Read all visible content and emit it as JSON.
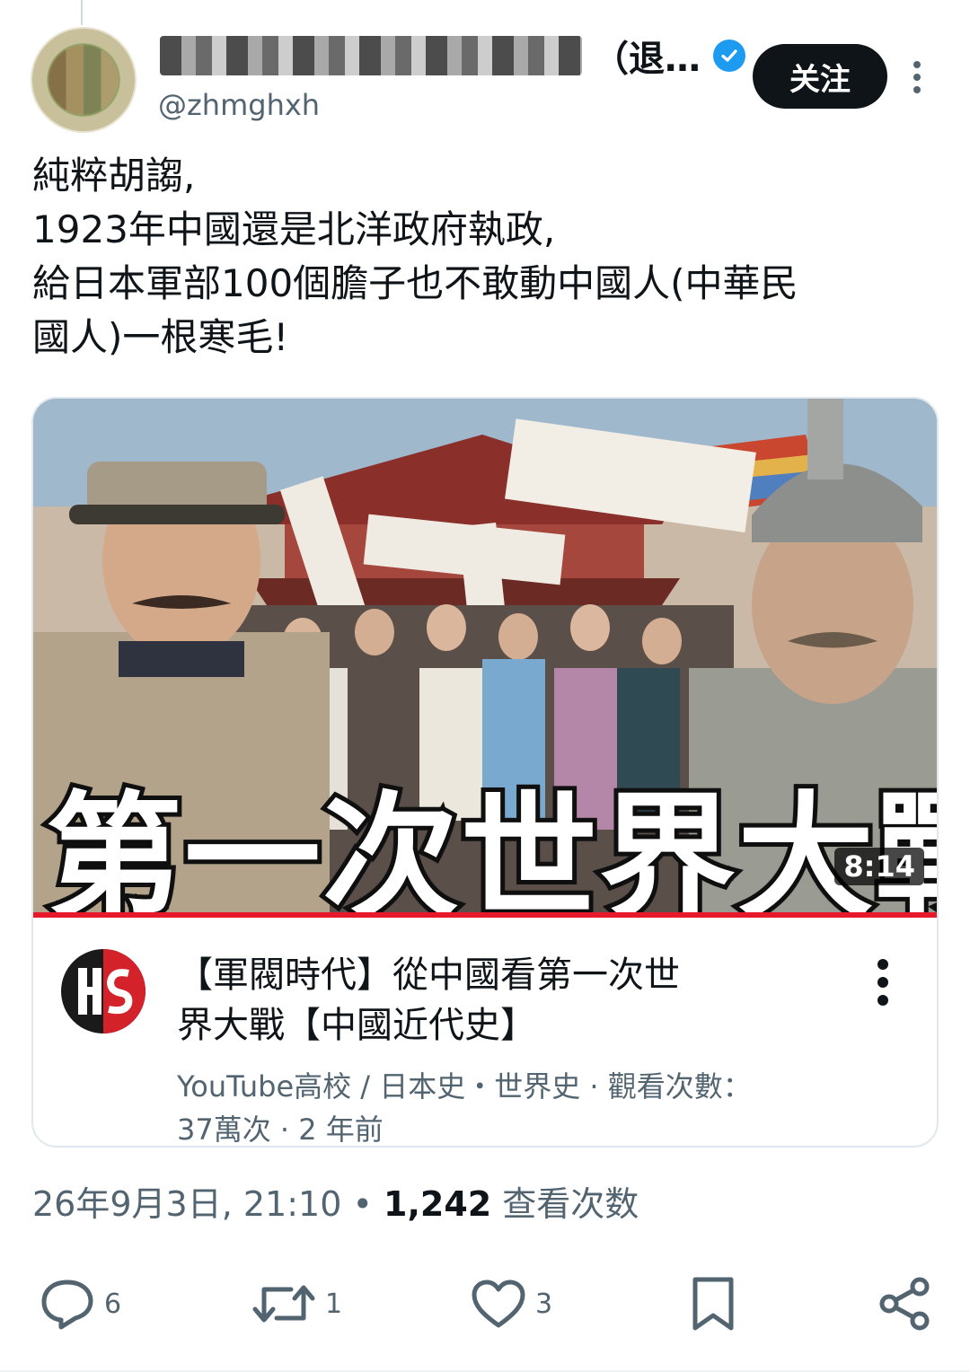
{
  "header": {
    "display_name_visible": "（退…",
    "handle": "@zhmghxh",
    "follow_label": "关注"
  },
  "tweet": {
    "lines": [
      "純粹胡謅,",
      "1923年中國還是北洋政府執政,",
      "給日本軍部100個膽子也不敢動中國人(中華民",
      "國人)一根寒毛!"
    ]
  },
  "card": {
    "thumbnail_title": "第一次世界大戰",
    "duration": "8:14",
    "title_lines": [
      "【軍閥時代】從中國看第一次世",
      "界大戰【中國近代史】"
    ],
    "meta_lines": [
      "YouTube高校 / 日本史・世界史 · 觀看次數：",
      "37萬次 · 2 年前"
    ]
  },
  "timestamp": {
    "datetime": "26年9月3日, 21:10",
    "separator": "•",
    "views_count": "1,242",
    "views_label": "查看次数"
  },
  "actions": {
    "reply_count": "6",
    "retweet_count": "1",
    "like_count": "3"
  },
  "colors": {
    "accent_blue": "#1d9bf0",
    "text_primary": "#0f1419",
    "text_secondary": "#536471",
    "progress_red": "#e8192c"
  }
}
